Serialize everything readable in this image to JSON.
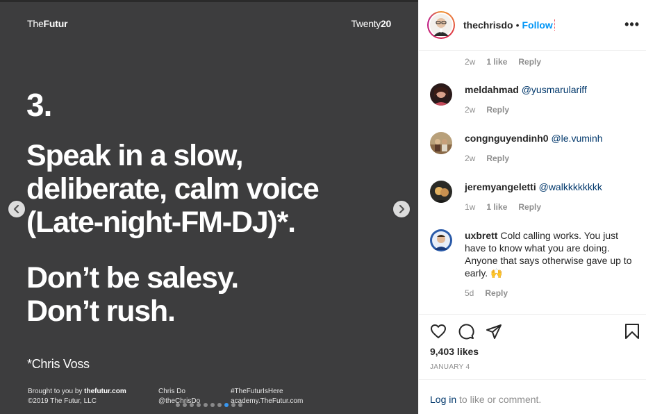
{
  "slide": {
    "brand_prefix": "The",
    "brand_bold": "Futur",
    "brand_right_prefix": "Twenty",
    "brand_right_bold": "20",
    "number": "3.",
    "main_lines": [
      "Speak in a slow,",
      "deliberate, calm voice",
      "(Late-night-FM-DJ)*."
    ],
    "sub_lines": [
      "Don’t be salesy.",
      "Don’t rush."
    ],
    "footnote": "*Chris Voss",
    "footer": {
      "col1_prefix": "Brought to you by ",
      "col1_bold": "thefutur.com",
      "col1_line2": "©2019 The Futur, LLC",
      "col2_line1": "Chris Do",
      "col2_line2": "@theChrisDo",
      "col3_line1": "#TheFuturIsHere",
      "col3_line2": "academy.TheFutur.com"
    },
    "dots_total": 10,
    "dots_active_index": 7,
    "prev_icon": "chevron-left-icon",
    "next_icon": "chevron-right-icon"
  },
  "header": {
    "username": "thechrisdo",
    "separator": "•",
    "follow_label": "Follow",
    "more_label": "•••"
  },
  "first_meta": {
    "time": "2w",
    "likes": "1 like",
    "reply": "Reply"
  },
  "comments": [
    {
      "user": "meldahmad",
      "text": "",
      "mention": "@yusmarulariff",
      "time": "2w",
      "likes": "",
      "reply": "Reply",
      "avatar_color": "#4a2a2a"
    },
    {
      "user": "congnguyendinh0",
      "text": "",
      "mention": "@le.vuminh",
      "time": "2w",
      "likes": "",
      "reply": "Reply",
      "avatar_color": "#9b8060"
    },
    {
      "user": "jeremyangeletti",
      "text": "",
      "mention": "@walkkkkkkkk",
      "time": "1w",
      "likes": "1 like",
      "reply": "Reply",
      "avatar_color": "#3a3a38"
    },
    {
      "user": "uxbrett",
      "text": "Cold calling works. You just have to know what you are doing. Anyone that says otherwise gave up to early. 🙌",
      "mention": "",
      "time": "5d",
      "likes": "",
      "reply": "Reply",
      "avatar_color": "#2a5aa8"
    }
  ],
  "actions": {
    "likes": "9,403 likes",
    "date": "JANUARY 4"
  },
  "login": {
    "link": "Log in",
    "rest": " to like or comment."
  },
  "colors": {
    "slide_bg": "#3d3d3e",
    "link_blue": "#0095f6",
    "mention_blue": "#00376b",
    "meta_gray": "#8e8e8e"
  }
}
